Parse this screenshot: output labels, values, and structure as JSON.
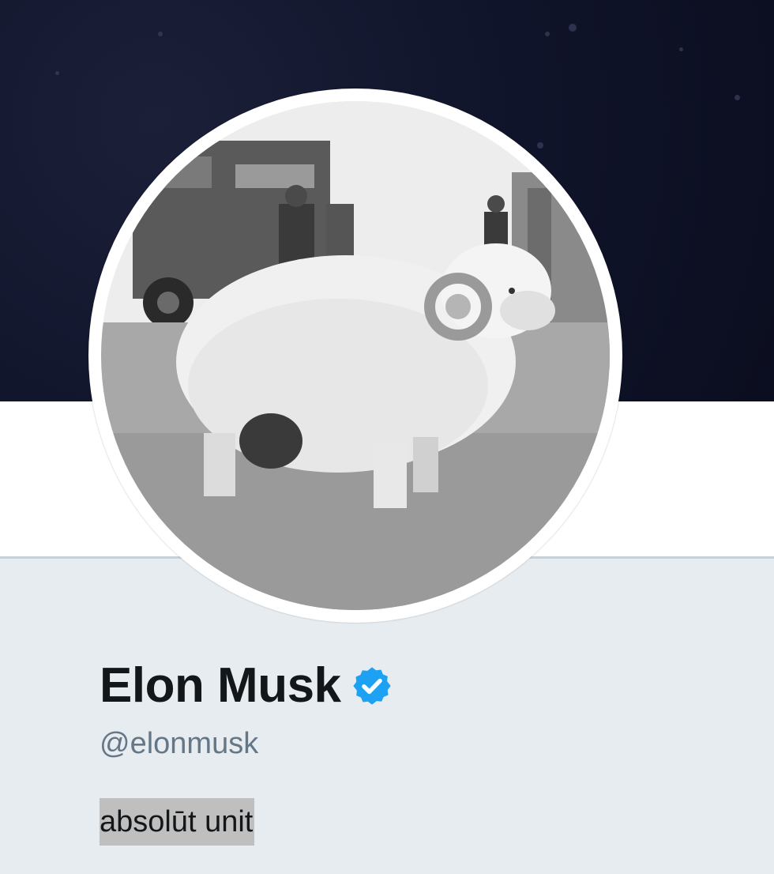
{
  "profile": {
    "display_name": "Elon Musk",
    "handle": "@elonmusk",
    "bio": "absolūt unit",
    "verified_icon": "verified-badge-icon",
    "avatar_subject": "ram-photo"
  },
  "colors": {
    "banner": "#10142a",
    "nav_bar": "#ffffff",
    "page_background": "#e6ecf0",
    "name": "#14171a",
    "handle": "#657786",
    "verified": "#1da1f2",
    "bio_highlight": "#bfbfbf"
  }
}
